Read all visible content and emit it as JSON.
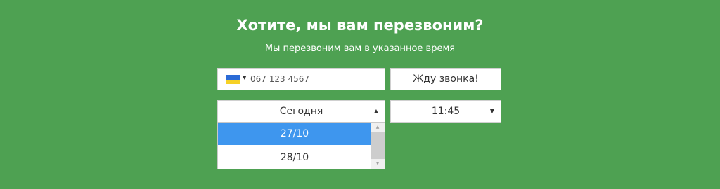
{
  "form": {
    "title": "Хотите, мы вам перезвоним?",
    "subtitle": "Мы перезвоним вам в указанное время",
    "phone": {
      "country_flag": "ukraine-flag-icon",
      "flag_colors": [
        "#2b6bd6",
        "#f6d126"
      ],
      "placeholder": "067 123 4567",
      "value": ""
    },
    "submit_label": "Жду звонка!",
    "day_select": {
      "value": "Сегодня",
      "options": [
        {
          "label": "27/10",
          "selected": true
        },
        {
          "label": "28/10",
          "selected": false
        }
      ]
    },
    "time_select": {
      "value": "11:45"
    }
  },
  "colors": {
    "background": "#4ea152",
    "selected_option": "#3e96ee"
  }
}
